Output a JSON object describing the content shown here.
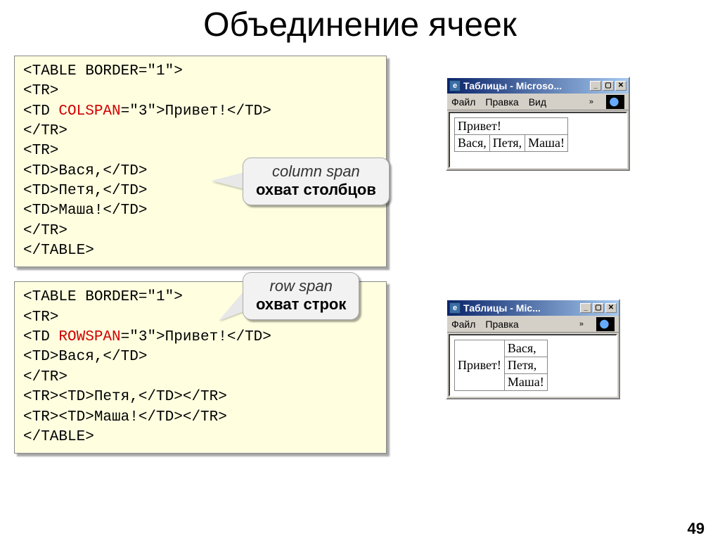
{
  "title": "Объединение ячеек",
  "code1": {
    "l1a": "<TABLE BORDER=\"1\">",
    "l2": "<TR>",
    "l3a": "   <TD ",
    "l3b": "COLSPAN",
    "l3c": "=\"3\">Привет!</TD>",
    "l4": "</TR>",
    "l5": "<TR>",
    "l6": "   <TD>Вася,</TD>",
    "l7": "   <TD>Петя,</TD>",
    "l8": "   <TD>Маша!</TD>",
    "l9": "</TR>",
    "l10": "</TABLE>"
  },
  "code2": {
    "l1": "<TABLE BORDER=\"1\">",
    "l2": "<TR>",
    "l3a": "   <TD ",
    "l3b": "ROWSPAN",
    "l3c": "=\"3\">Привет!</TD>",
    "l4": "   <TD>Вася,</TD>",
    "l5": "</TR>",
    "l6": "<TR><TD>Петя,</TD></TR>",
    "l7": "<TR><TD>Маша!</TD></TR>",
    "l8": "</TABLE>"
  },
  "callout1": {
    "en": "column span",
    "ru": "охват столбцов"
  },
  "callout2": {
    "en": "row span",
    "ru": "охват строк"
  },
  "ie1": {
    "title": "Таблицы - Microso...",
    "menu": {
      "file": "Файл",
      "edit": "Правка",
      "view": "Вид"
    },
    "table": {
      "r1c1": "Привет!",
      "r2c1": "Вася,",
      "r2c2": "Петя,",
      "r2c3": "Маша!"
    }
  },
  "ie2": {
    "title": "Таблицы - Mic...",
    "menu": {
      "file": "Файл",
      "edit": "Правка"
    },
    "table": {
      "c1": "Привет!",
      "r1": "Вася,",
      "r2": "Петя,",
      "r3": "Маша!"
    }
  },
  "page_number": "49"
}
